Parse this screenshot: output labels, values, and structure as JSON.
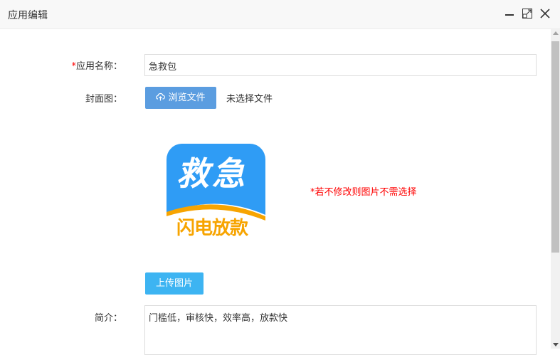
{
  "window": {
    "title": "应用编辑"
  },
  "form": {
    "name_required": "*",
    "name_label": "应用名称：",
    "name_value": "急救包",
    "cover_label": "封面图：",
    "browse_label": "浏览文件",
    "no_file": "未选择文件",
    "logo": {
      "main_text": "救急",
      "sub_text": "闪电放款"
    },
    "hint": "*若不修改则图片不需选择",
    "upload_label": "上传图片",
    "intro_label": "简介：",
    "intro_value": "门槛低，审核快，效率高，放款快"
  },
  "colors": {
    "primary": "#5b9de0",
    "upload": "#3db4f2",
    "logo_blue": "#2f9cf5",
    "logo_orange": "#f7a400",
    "hint": "#ff0000"
  }
}
